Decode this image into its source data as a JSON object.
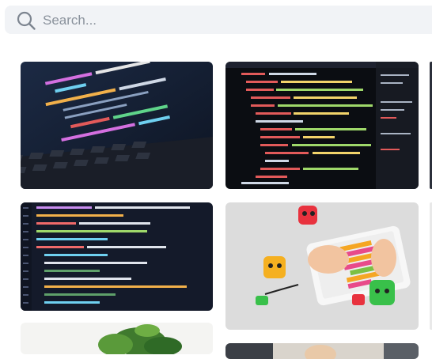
{
  "search": {
    "placeholder": "Search...",
    "value": ""
  },
  "gallery": {
    "images": [
      {
        "name": "laptop-code-screen-photo"
      },
      {
        "name": "html-code-monitor-photo"
      },
      {
        "name": "code-editor-screen-photo"
      },
      {
        "name": "kids-tablet-coding-blocks-photo"
      },
      {
        "name": "plant-photo"
      },
      {
        "name": "person-photo"
      }
    ]
  },
  "colors": {
    "search_bg": "#f1f3f6",
    "placeholder": "#8a929c",
    "code_dark": "#141a2a"
  }
}
